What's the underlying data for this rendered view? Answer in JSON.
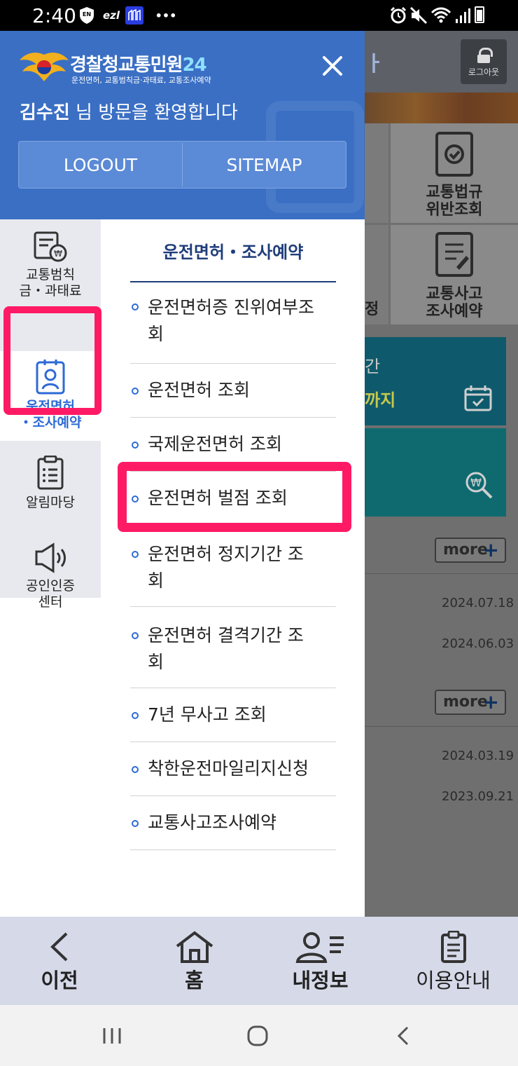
{
  "status_bar": {
    "time": "2:40",
    "icons": [
      "en-badge-icon",
      "ezl-icon",
      "app-icon",
      "more-dots-icon",
      "alarm-icon",
      "mute-icon",
      "wifi-icon",
      "signal-icon",
      "battery-icon"
    ],
    "ezl": "ezl",
    "dots": "•••"
  },
  "drawer": {
    "logo_title": "경찰청교통민원",
    "logo_title_num": "24",
    "logo_subtitle": "운전면허, 교통범칙금·과태료, 교통조사예약",
    "welcome_name": "김수진",
    "welcome_suffix": " 님 방문을 환영합니다",
    "logout_label": "LOGOUT",
    "sitemap_label": "SITEMAP"
  },
  "categories": [
    {
      "label1": "교통범칙",
      "label2": "금・과태료",
      "icon": "fine-receipt-icon"
    },
    {
      "label1": "운전면허",
      "label2": "・조사예약",
      "icon": "license-card-icon",
      "active": true
    },
    {
      "label1": "알림마당",
      "label2": "",
      "icon": "notice-board-icon"
    },
    {
      "label1": "공인인증",
      "label2": "센터",
      "icon": "certificate-speaker-icon"
    }
  ],
  "submenu": {
    "title": "운전면허・조사예약",
    "items": [
      {
        "line1": "운전면허증 진위여부조",
        "line2": "회"
      },
      {
        "line1": "운전면허 조회",
        "line2": ""
      },
      {
        "line1": "국제운전면허 조회",
        "line2": ""
      },
      {
        "line1": "운전면허 벌점 조회",
        "line2": ""
      },
      {
        "line1": "운전면허 정지기간 조",
        "line2": "회"
      },
      {
        "line1": "운전면허 결격기간 조",
        "line2": "회"
      },
      {
        "line1": "7년 무사고 조회",
        "line2": ""
      },
      {
        "line1": "착한운전마일리지신청",
        "line2": ""
      },
      {
        "line1": "교통사고조사예약",
        "line2": ""
      }
    ]
  },
  "background_page": {
    "logout_button": "로그아웃",
    "tile_violation": [
      "교통법규",
      "위반조회"
    ],
    "tile_accident": [
      "교통사고",
      "조사예약"
    ],
    "partial_text_1": "간",
    "partial_text_2": "까지",
    "partial_letter_1": "ㅏ",
    "partial_letter_2": "정",
    "more_label": "more",
    "dates_group1": [
      "2024.07.18",
      "2024.06.03"
    ],
    "dates_group2": [
      "2024.03.19",
      "2023.09.21"
    ]
  },
  "bottom_nav": [
    {
      "label": "이전",
      "icon": "back-chevron-icon"
    },
    {
      "label": "홈",
      "icon": "home-icon"
    },
    {
      "label": "내정보",
      "icon": "my-info-icon"
    },
    {
      "label": "이용안내",
      "icon": "guide-clipboard-icon"
    }
  ],
  "system_nav": [
    "recent-apps-icon",
    "home-circle-icon",
    "back-icon"
  ]
}
